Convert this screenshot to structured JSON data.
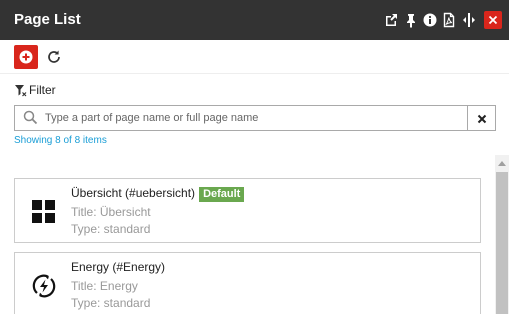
{
  "window": {
    "title": "Page List",
    "header_icons": [
      "external-link-icon",
      "pin-icon",
      "info-icon",
      "pdf-icon",
      "expand-icon",
      "close-icon"
    ],
    "accent_color": "#d9261c",
    "header_color": "#333333"
  },
  "toolbar": {
    "add_icon": "plus-circle-icon",
    "refresh_icon": "refresh-icon"
  },
  "filter": {
    "label": "Filter",
    "placeholder": "Type a part of page name or full page name",
    "value": "",
    "status": "Showing 8 of 8 items"
  },
  "pages": [
    {
      "name": "Übersicht (#uebersicht)",
      "badge": "Default",
      "title": "Title: Übersicht",
      "type": "Type: standard",
      "icon": "dashboard-icon"
    },
    {
      "name": "Energy (#Energy)",
      "badge": "",
      "title": "Title: Energy",
      "type": "Type: standard",
      "icon": "energy-icon"
    }
  ]
}
